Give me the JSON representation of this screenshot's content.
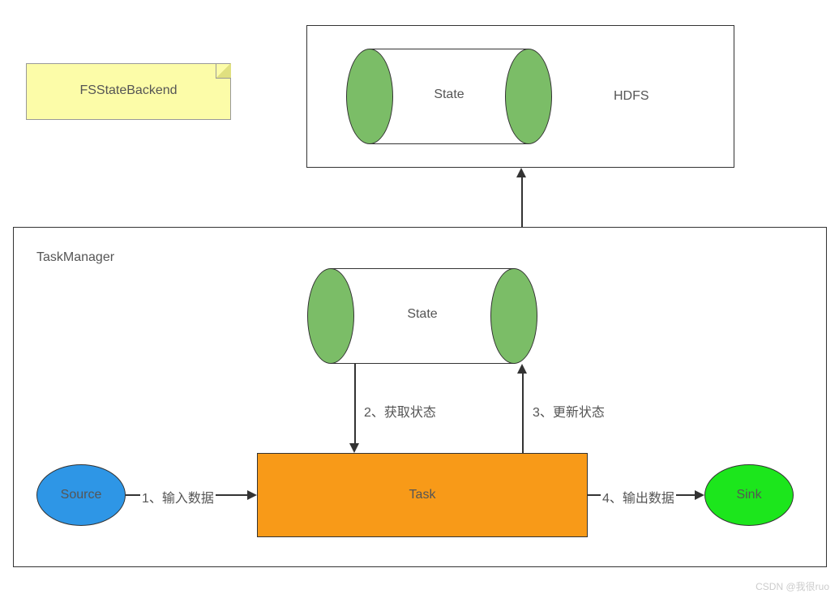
{
  "note": {
    "title": "FSStateBackend"
  },
  "hdfs_box": {
    "state_label": "State",
    "hdfs_label": "HDFS"
  },
  "tm_box": {
    "title": "TaskManager",
    "state_label": "State"
  },
  "nodes": {
    "source": "Source",
    "task": "Task",
    "sink": "Sink"
  },
  "edges": {
    "input": "1、输入数据",
    "get_state": "2、获取状态",
    "update_state": "3、更新状态",
    "output": "4、输出数据"
  },
  "watermark": "CSDN @我很ruo",
  "colors": {
    "note_bg": "#FCFCA8",
    "cyl_green": "#7BBD67",
    "task_orange": "#F89A18",
    "source_blue": "#2E96E6",
    "sink_green": "#1CE61C"
  },
  "chart_data": {
    "type": "diagram",
    "title": "FSStateBackend",
    "containers": [
      {
        "id": "hdfs",
        "label": "HDFS",
        "contains": [
          "state_hdfs"
        ]
      },
      {
        "id": "taskmanager",
        "label": "TaskManager",
        "contains": [
          "state_tm",
          "source",
          "task",
          "sink"
        ]
      }
    ],
    "nodes": [
      {
        "id": "state_hdfs",
        "label": "State",
        "shape": "cylinder"
      },
      {
        "id": "state_tm",
        "label": "State",
        "shape": "cylinder"
      },
      {
        "id": "source",
        "label": "Source",
        "shape": "ellipse",
        "fill": "#2E96E6"
      },
      {
        "id": "task",
        "label": "Task",
        "shape": "rect",
        "fill": "#F89A18"
      },
      {
        "id": "sink",
        "label": "Sink",
        "shape": "ellipse",
        "fill": "#1CE61C"
      }
    ],
    "edges": [
      {
        "from": "source",
        "to": "task",
        "label": "1、输入数据"
      },
      {
        "from": "state_tm",
        "to": "task",
        "label": "2、获取状态"
      },
      {
        "from": "task",
        "to": "state_tm",
        "label": "3、更新状态"
      },
      {
        "from": "task",
        "to": "sink",
        "label": "4、输出数据"
      },
      {
        "from": "state_tm",
        "to": "state_hdfs",
        "label": ""
      }
    ]
  }
}
